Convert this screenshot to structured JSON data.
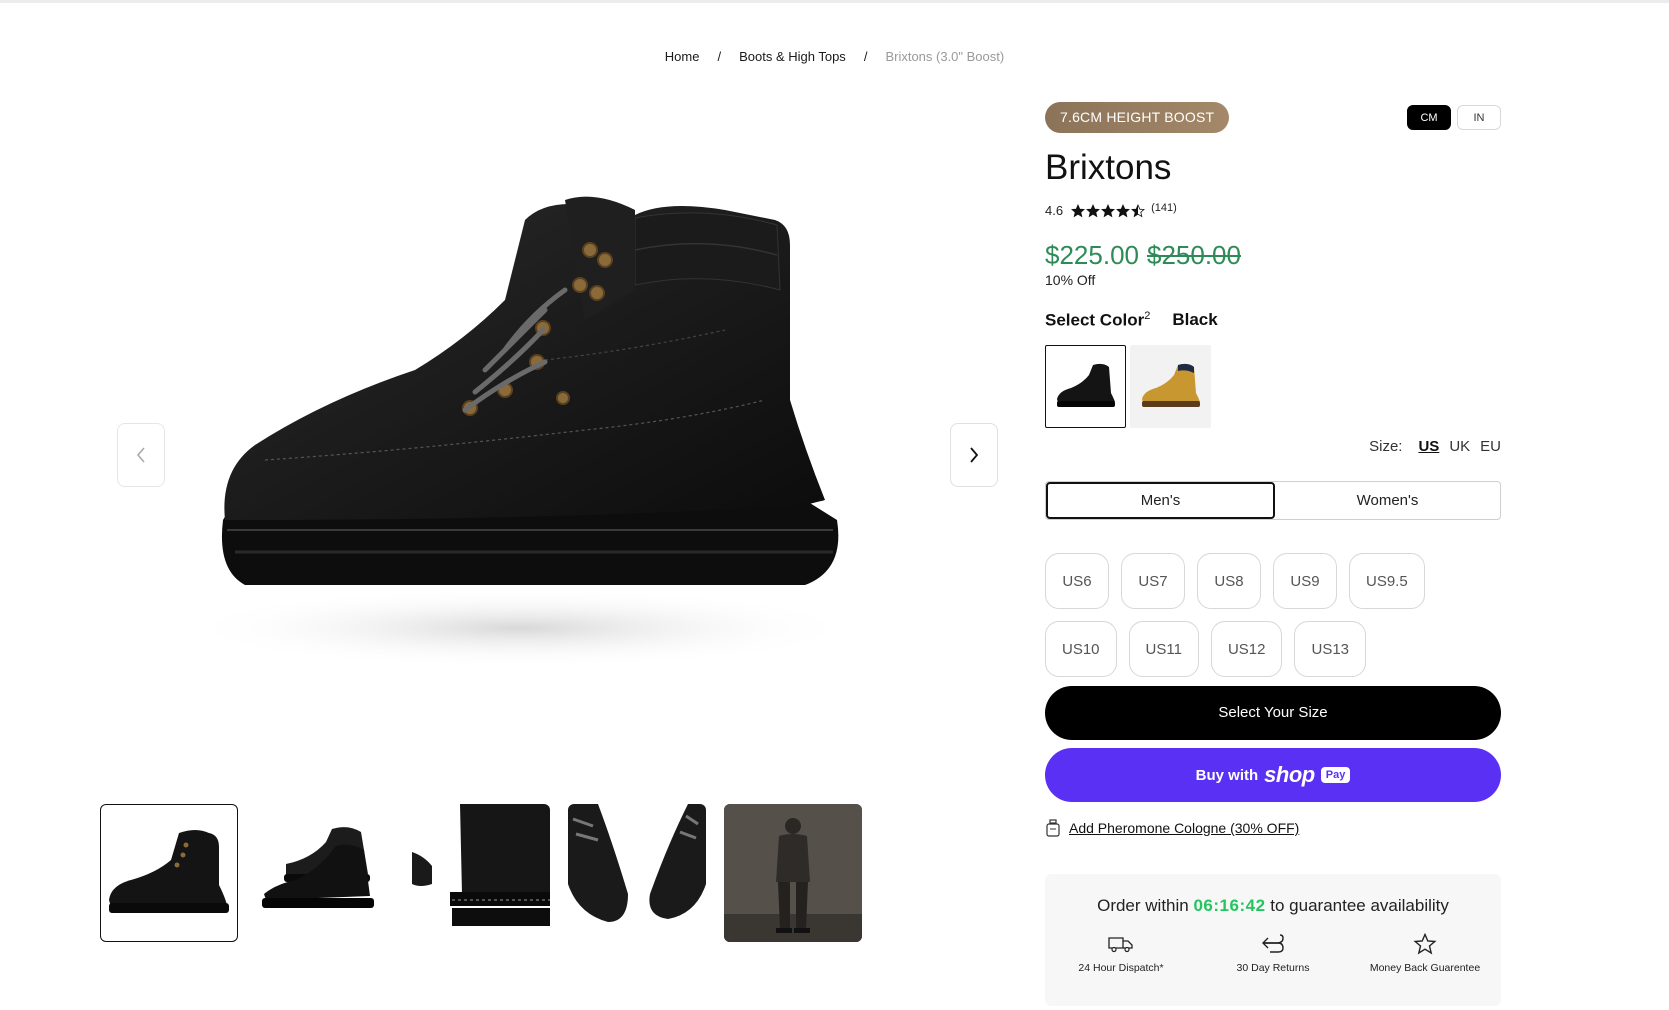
{
  "breadcrumb": {
    "items": [
      "Home",
      "Boots & High Tops",
      "Brixtons (3.0\" Boost)"
    ],
    "separator": "/"
  },
  "gallery": {
    "prev_icon": "chevron-left-icon",
    "next_icon": "chevron-right-icon",
    "thumbnails": [
      "black boot side view",
      "pair of black boots",
      "boot sole close-up",
      "boot laces top view",
      "model wearing boots"
    ],
    "active_thumbnail": 1
  },
  "product": {
    "badge": "7.6CM HEIGHT BOOST",
    "units": [
      "CM",
      "IN"
    ],
    "active_unit": "CM",
    "title": "Brixtons",
    "rating": "4.6",
    "stars": 4.5,
    "review_count": "(141)",
    "price": "$225.00",
    "compare_price": "$250.00",
    "discount": "10% Off",
    "color_label": "Select Color",
    "color_count": "2",
    "selected_color": "Black",
    "swatches": [
      "black",
      "tan"
    ],
    "size_label": "Size:",
    "size_systems": [
      "US",
      "UK",
      "EU"
    ],
    "active_size_system": "US",
    "genders": [
      "Men's",
      "Women's"
    ],
    "active_gender": "Men's",
    "sizes": [
      "US6",
      "US7",
      "US8",
      "US9",
      "US9.5",
      "US10",
      "US11",
      "US12",
      "US13"
    ],
    "select_size_label": "Select Your Size",
    "shoppay_buy": "Buy with",
    "shoppay_shop": "shop",
    "shoppay_pay": "Pay",
    "addon_label": "Add Pheromone Cologne (30% OFF)"
  },
  "order": {
    "prefix": "Order within",
    "timer": "06:16:42",
    "suffix": "to guarantee availability",
    "perks": [
      {
        "icon": "truck-icon",
        "label": "24 Hour Dispatch*"
      },
      {
        "icon": "return-arrow-icon",
        "label": "30 Day Returns"
      },
      {
        "icon": "star-icon",
        "label": "Money Back Guarentee"
      }
    ]
  },
  "colors": {
    "price_green": "#2e8b57",
    "timer_green": "#22c55e",
    "shoppay_purple": "#5a31f4",
    "badge_brown": "#957b5f"
  }
}
